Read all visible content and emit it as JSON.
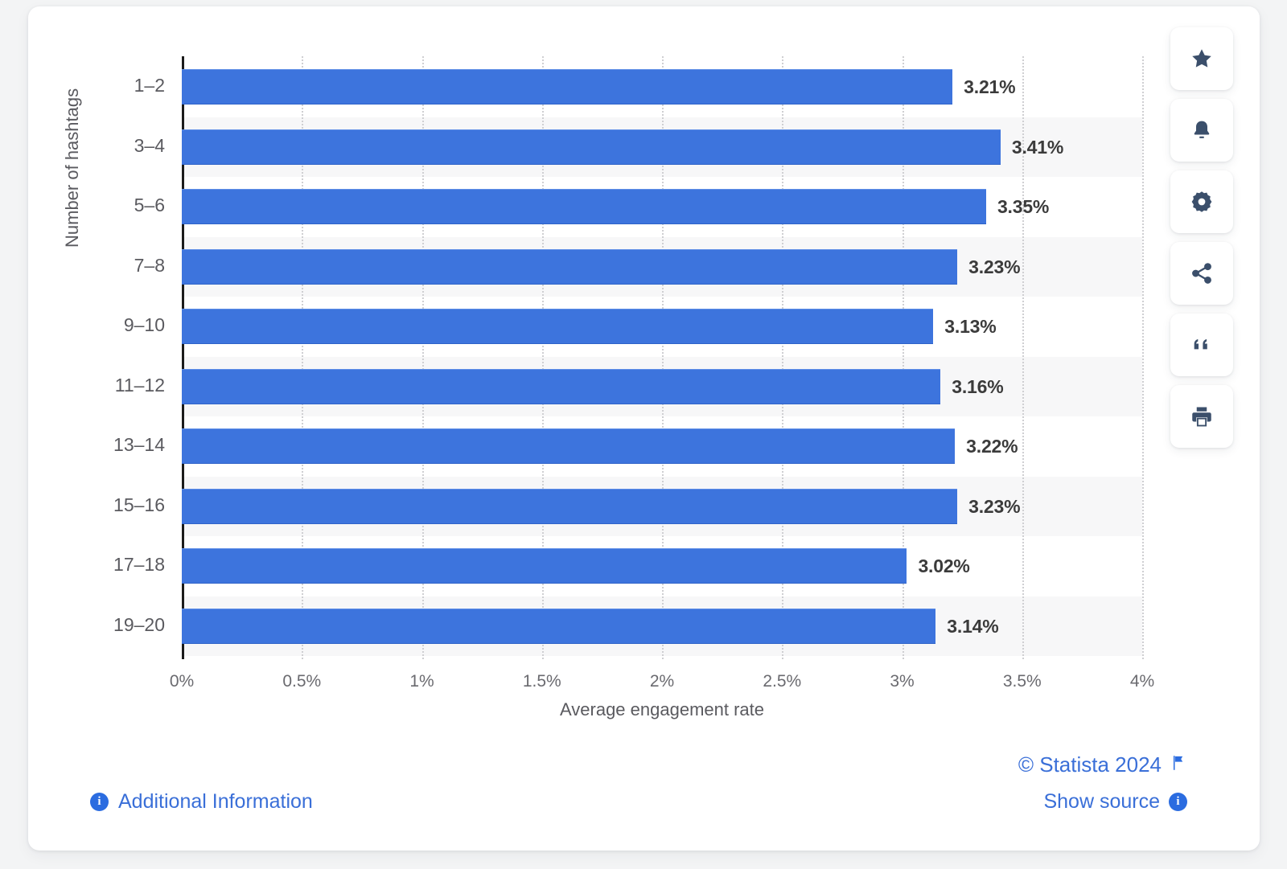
{
  "chart_data": {
    "type": "bar",
    "orientation": "horizontal",
    "title": "",
    "xlabel": "Average engagement rate",
    "ylabel": "Number of hashtags",
    "categories": [
      "1–2",
      "3–4",
      "5–6",
      "7–8",
      "9–10",
      "11–12",
      "13–14",
      "15–16",
      "17–18",
      "19–20"
    ],
    "values": [
      3.21,
      3.41,
      3.35,
      3.23,
      3.13,
      3.16,
      3.22,
      3.23,
      3.02,
      3.14
    ],
    "value_labels": [
      "3.21%",
      "3.41%",
      "3.35%",
      "3.23%",
      "3.13%",
      "3.16%",
      "3.22%",
      "3.23%",
      "3.02%",
      "3.14%"
    ],
    "xticks": [
      0,
      0.5,
      1,
      1.5,
      2,
      2.5,
      3,
      3.5,
      4
    ],
    "xtick_labels": [
      "0%",
      "0.5%",
      "1%",
      "1.5%",
      "2%",
      "2.5%",
      "3%",
      "3.5%",
      "4%"
    ],
    "xlim": [
      0,
      4
    ],
    "grid": "vertical-dotted",
    "legend": "none",
    "bar_color": "#3d74dd",
    "band_color": "#f7f7f8"
  },
  "toolbar": {
    "items": [
      {
        "name": "favorite-button",
        "icon": "star-icon"
      },
      {
        "name": "alert-button",
        "icon": "bell-icon"
      },
      {
        "name": "settings-button",
        "icon": "gear-icon"
      },
      {
        "name": "share-button",
        "icon": "share-icon"
      },
      {
        "name": "cite-button",
        "icon": "quote-icon"
      },
      {
        "name": "print-button",
        "icon": "print-icon"
      }
    ]
  },
  "footer": {
    "additional_information": "Additional Information",
    "copyright": "© Statista 2024",
    "show_source": "Show source",
    "info_glyph": "i",
    "flag_icon": "flag-icon"
  }
}
